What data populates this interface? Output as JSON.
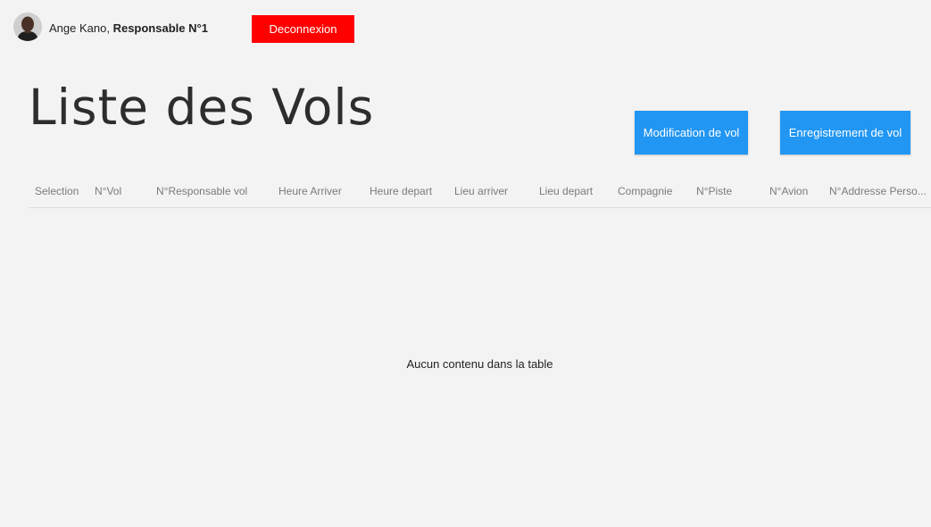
{
  "user": {
    "name": "Ange Kano,",
    "role": "Responsable N°1"
  },
  "header": {
    "logout_label": "Deconnexion"
  },
  "page": {
    "title": "Liste des Vols"
  },
  "actions": {
    "modify_label": "Modification de vol",
    "register_label": "Enregistrement de vol"
  },
  "table": {
    "columns": [
      "Selection",
      "N°Vol",
      "N°Responsable vol",
      "Heure Arriver",
      "Heure depart",
      "Lieu arriver",
      "Lieu depart",
      "Compagnie",
      "N°Piste",
      "N°Avion",
      "N°Addresse Perso..."
    ],
    "empty_message": "Aucun contenu dans la table"
  },
  "colors": {
    "background": "#f3f3f3",
    "logout": "#ff0000",
    "primary": "#2196f3"
  }
}
